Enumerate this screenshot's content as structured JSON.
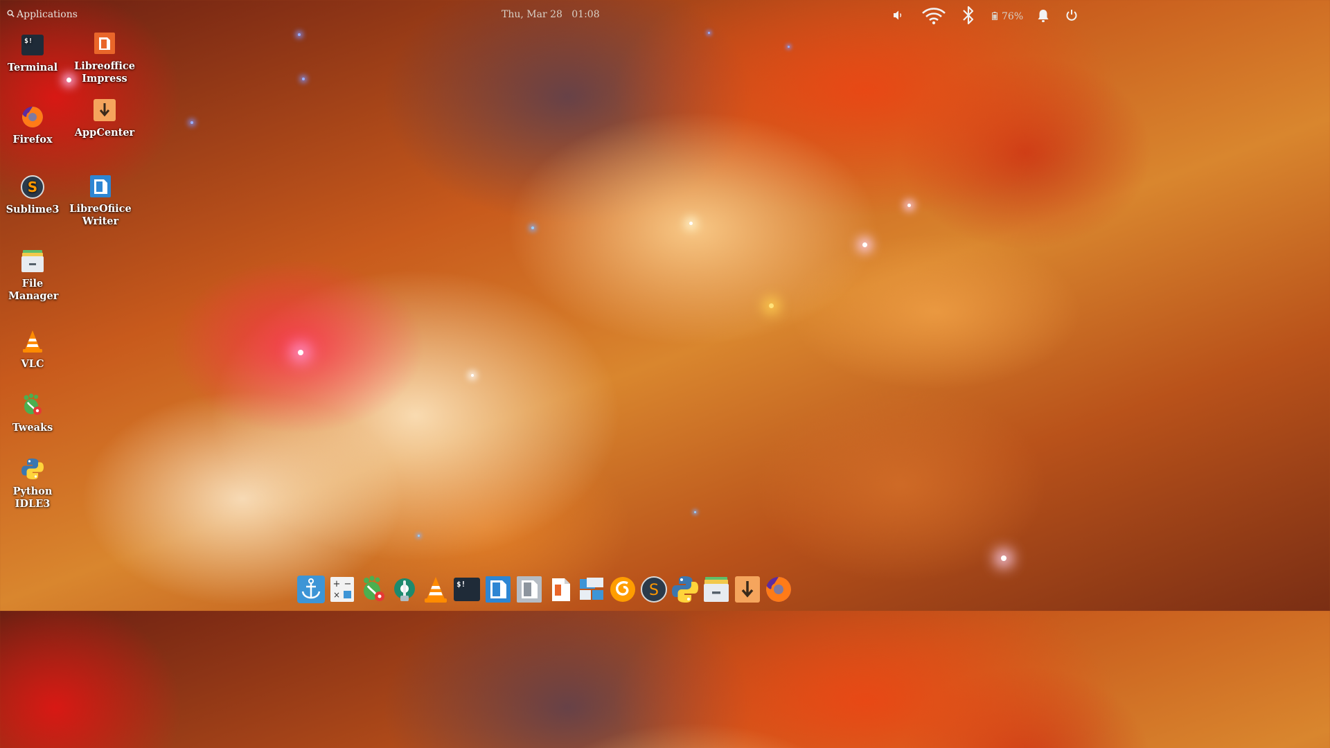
{
  "topbar": {
    "applications_label": "Applications",
    "clock": "Thu, Mar 28   01:08",
    "battery_percent": "76%"
  },
  "desktop": {
    "icons": [
      {
        "label": "Terminal",
        "icon": "terminal-icon"
      },
      {
        "label": "Libreoffice Impress",
        "icon": "libreoffice-impress-icon"
      },
      {
        "label": "Firefox",
        "icon": "firefox-icon"
      },
      {
        "label": "AppCenter",
        "icon": "appcenter-icon"
      },
      {
        "label": "Sublime3",
        "icon": "sublime-icon"
      },
      {
        "label": "LibreOfiice Writer",
        "icon": "libreoffice-writer-icon"
      },
      {
        "label": "File Manager",
        "icon": "file-manager-icon"
      },
      {
        "label": "VLC",
        "icon": "vlc-icon"
      },
      {
        "label": "Tweaks",
        "icon": "tweaks-icon"
      },
      {
        "label": "Python IDLE3",
        "icon": "python-icon"
      }
    ]
  },
  "dock": {
    "items": [
      "anchor-icon",
      "calculator-icon",
      "tweaks-icon",
      "settings-icon",
      "vlc-icon",
      "terminal-icon",
      "writer-icon",
      "document-icon",
      "impress-icon",
      "multitasking-icon",
      "swirl-app-icon",
      "sublime-icon",
      "python-icon",
      "file-manager-icon",
      "appcenter-icon",
      "firefox-icon"
    ]
  },
  "colors": {
    "panel_text": "#e6e1dc",
    "terminal_bg": "#1f2b38",
    "libreoffice_orange": "#e9662a",
    "writer_blue": "#2d86d3",
    "firefox_orange": "#ff7b17"
  }
}
